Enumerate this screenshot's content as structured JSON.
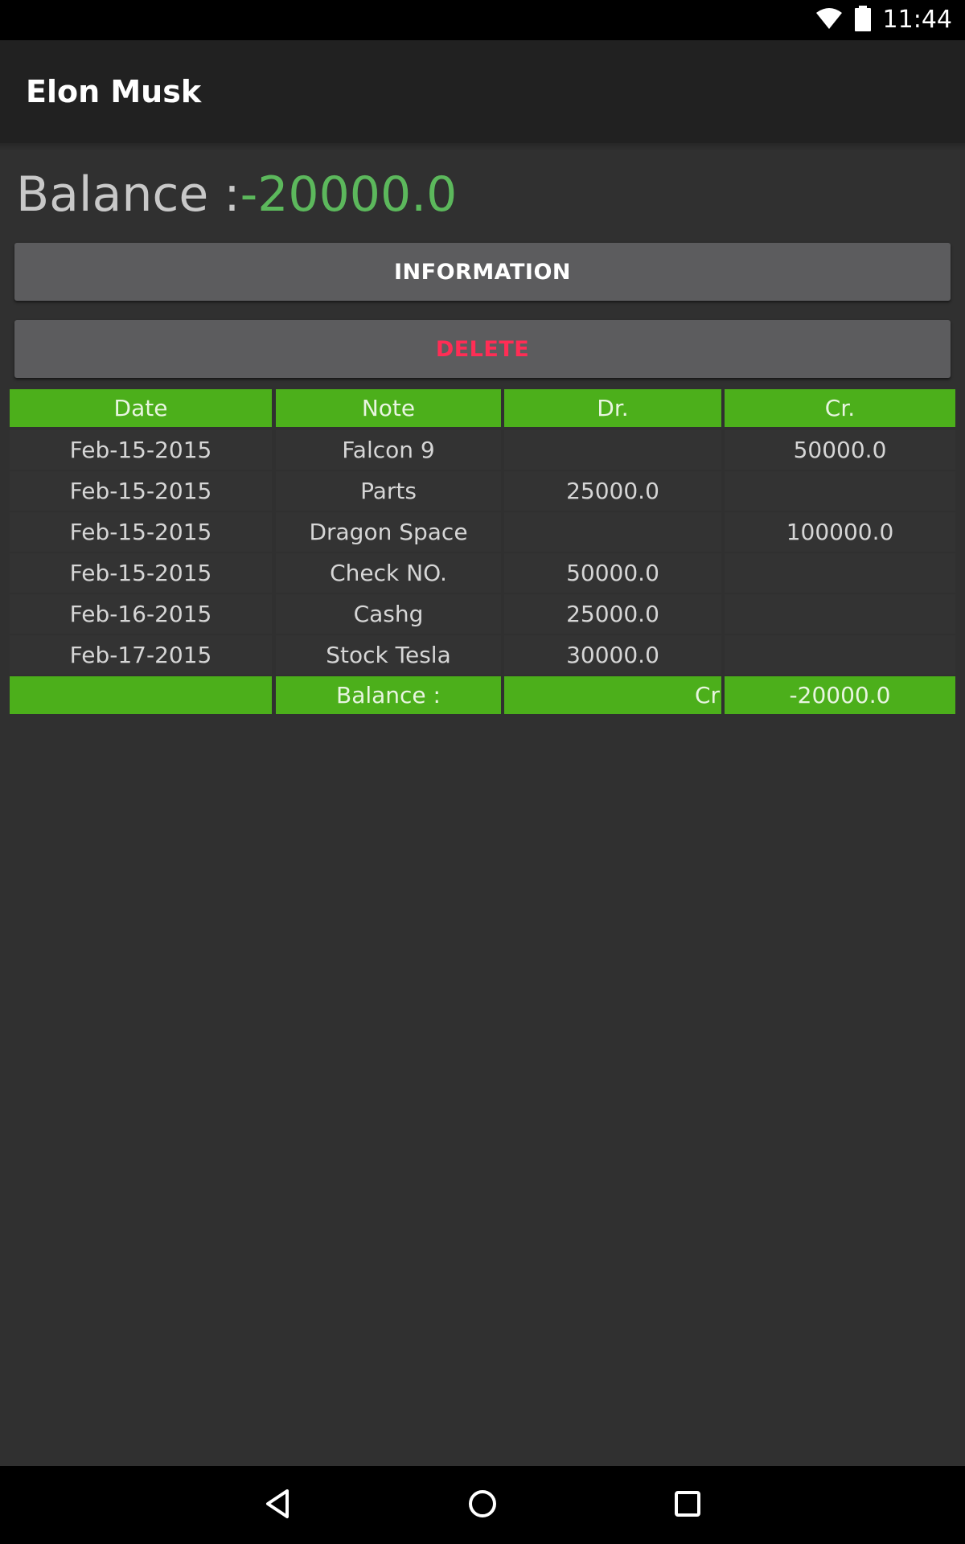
{
  "status_bar": {
    "time": "11:44",
    "icons": [
      "wifi-icon",
      "battery-icon"
    ]
  },
  "app_bar": {
    "title": "Elon Musk"
  },
  "balance": {
    "label": "Balance :",
    "value": "-20000.0"
  },
  "buttons": {
    "information": "INFORMATION",
    "delete": "DELETE"
  },
  "table": {
    "headers": [
      "Date",
      "Note",
      "Dr.",
      "Cr."
    ],
    "rows": [
      [
        "Feb-15-2015",
        "Falcon 9",
        "",
        "50000.0"
      ],
      [
        "Feb-15-2015",
        "Parts",
        "25000.0",
        ""
      ],
      [
        "Feb-15-2015",
        "Dragon Space",
        "",
        "100000.0"
      ],
      [
        "Feb-15-2015",
        "Check NO.",
        "50000.0",
        ""
      ],
      [
        "Feb-16-2015",
        "Cashg",
        "25000.0",
        ""
      ],
      [
        "Feb-17-2015",
        "Stock Tesla",
        "30000.0",
        ""
      ]
    ],
    "footer": [
      "",
      "Balance :",
      "Cr",
      "-20000.0"
    ]
  },
  "nav_bar": {
    "icons": [
      "back-icon",
      "home-icon",
      "recents-icon"
    ]
  },
  "colors": {
    "accent_green": "#4caf1b",
    "balance_green": "#5cb85c",
    "delete_red": "#ff2d55",
    "background": "#303030"
  }
}
